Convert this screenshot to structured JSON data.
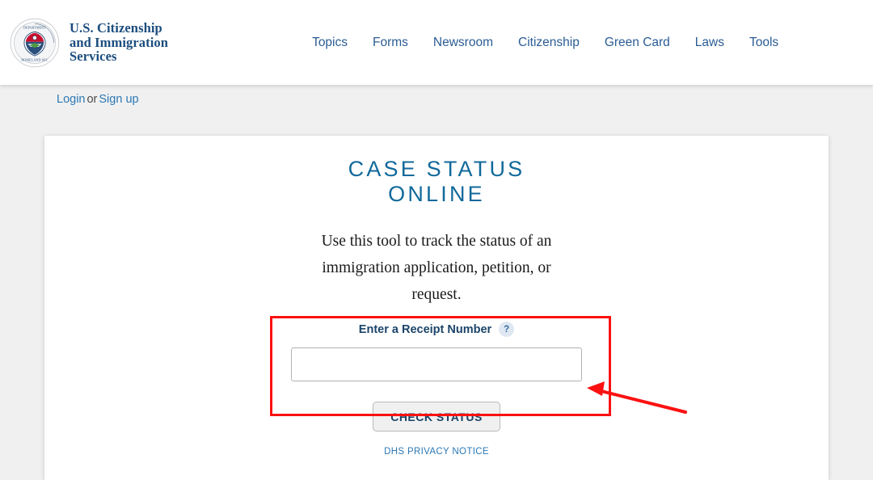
{
  "header": {
    "logo_icon": "dhs-seal-icon",
    "brand_lines": [
      "U.S. Citizenship",
      "and Immigration",
      "Services"
    ],
    "nav": [
      {
        "label": "Topics"
      },
      {
        "label": "Forms"
      },
      {
        "label": "Newsroom"
      },
      {
        "label": "Citizenship"
      },
      {
        "label": "Green Card"
      },
      {
        "label": "Laws"
      },
      {
        "label": "Tools"
      }
    ]
  },
  "account_bar": {
    "login_label": "Login",
    "separator": "or",
    "signup_label": "Sign up"
  },
  "main": {
    "title_line1": "CASE STATUS",
    "title_line2": "ONLINE",
    "description": "Use this tool to track the status of an immigration application, petition, or request.",
    "form": {
      "field_label": "Enter a Receipt Number",
      "help_icon": "question-mark-icon",
      "help_glyph": "?",
      "receipt_value": "",
      "receipt_placeholder": "",
      "submit_label": "CHECK STATUS"
    },
    "privacy_link": "DHS PRIVACY NOTICE"
  },
  "annotation": {
    "box_color": "#fb1111",
    "arrow_color": "#fb1111",
    "target": "receipt-number-input"
  },
  "colors": {
    "brand_navy": "#1b4d7e",
    "nav_blue": "#2b5c93",
    "title_teal": "#11699b",
    "link_blue": "#2b78b5",
    "page_bg": "#f0f0f0",
    "card_bg": "#ffffff"
  }
}
